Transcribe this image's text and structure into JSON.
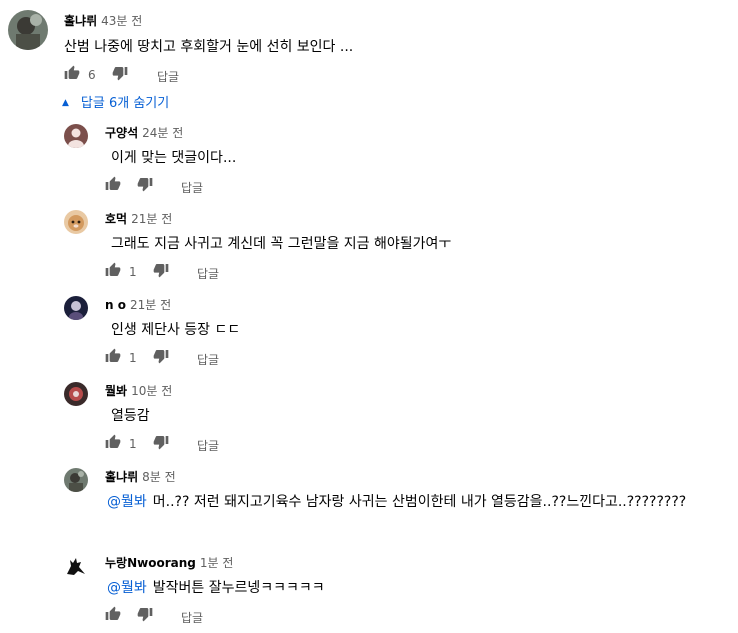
{
  "top_comment": {
    "author": "홀냐뤼",
    "time": "43분 전",
    "text": "산범 나중에 땅치고 후회할거 눈에 선히 보인다 ...",
    "likes": "6",
    "reply_label": "답글"
  },
  "replies_toggle": {
    "label": "답글 6개 숨기기"
  },
  "replies": [
    {
      "author": "구양석",
      "time": "24분 전",
      "mention": "",
      "text": "이게 맞는 댓글이다...",
      "likes": "",
      "reply_label": "답글"
    },
    {
      "author": "호먹",
      "time": "21분 전",
      "mention": "",
      "text": "그래도 지금 사귀고 계신데 꼭 그런말을 지금 해야될가여ㅜ",
      "likes": "1",
      "reply_label": "답글"
    },
    {
      "author": "n o",
      "time": "21분 전",
      "mention": "",
      "text": "인생 제단사 등장 ㄷㄷ",
      "likes": "1",
      "reply_label": "답글"
    },
    {
      "author": "뭘봐",
      "time": "10분 전",
      "mention": "",
      "text": "열등감",
      "likes": "1",
      "reply_label": "답글"
    },
    {
      "author": "홀냐뤼",
      "time": "8분 전",
      "mention": "@뭘봐",
      "text": "머..?? 저런 돼지고기육수 남자랑 사귀는 산범이한테 내가 열등감을..??느낀다고..????????",
      "likes": "",
      "reply_label": ""
    },
    {
      "author": "누랑Nwoorang",
      "time": "1분 전",
      "mention": "@뭘봐",
      "text": "발작버튼 잘누르넹ㅋㅋㅋㅋㅋ",
      "likes": "",
      "reply_label": "답글"
    }
  ],
  "colors": {
    "link": "#065fd4",
    "secondary": "#606060",
    "text": "#030303"
  }
}
